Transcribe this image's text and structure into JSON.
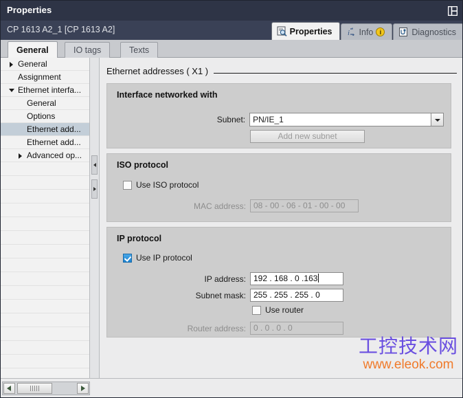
{
  "window": {
    "title": "Properties",
    "dock_icon": "panel-layout-icon",
    "device_name": "CP 1613 A2_1 [CP 1613 A2]"
  },
  "top_tabs": [
    {
      "label": "Properties",
      "icon": "properties-magnifier-icon",
      "active": true,
      "badge": ""
    },
    {
      "label": "Info",
      "icon": "info-arrow-icon",
      "active": false,
      "badge": "i"
    },
    {
      "label": "Diagnostics",
      "icon": "diagnostics-icon",
      "active": false,
      "badge": ""
    }
  ],
  "sub_tabs": [
    {
      "label": "General",
      "active": true
    },
    {
      "label": "IO tags",
      "active": false
    },
    {
      "label": "Texts",
      "active": false
    }
  ],
  "sidebar": {
    "items": [
      {
        "label": "General",
        "indent": 1,
        "arrow": "collapsed",
        "selected": false
      },
      {
        "label": "Assignment",
        "indent": 1,
        "arrow": "none",
        "selected": false
      },
      {
        "label": "Ethernet interfa...",
        "indent": 1,
        "arrow": "expanded",
        "selected": false
      },
      {
        "label": "General",
        "indent": 2,
        "arrow": "none",
        "selected": false
      },
      {
        "label": "Options",
        "indent": 2,
        "arrow": "none",
        "selected": false
      },
      {
        "label": "Ethernet add...",
        "indent": 2,
        "arrow": "none",
        "selected": true
      },
      {
        "label": "Ethernet add...",
        "indent": 2,
        "arrow": "none",
        "selected": false
      },
      {
        "label": "Advanced op...",
        "indent": 2,
        "arrow": "collapsed",
        "selected": false
      }
    ]
  },
  "splitter": {
    "collapse_left_icon": "collapse-left-arrow-icon",
    "collapse_right_icon": "collapse-right-arrow-icon"
  },
  "content": {
    "page_title": "Ethernet addresses ( X1 )",
    "groups": {
      "interface": {
        "title": "Interface networked with",
        "subnet_label": "Subnet:",
        "subnet_value": "PN/IE_1",
        "add_subnet_label": "Add new subnet"
      },
      "iso": {
        "title": "ISO protocol",
        "use_iso_label": "Use ISO protocol",
        "use_iso_checked": false,
        "mac_label": "MAC address:",
        "mac_value": "08  - 00  - 06  - 01  - 00  - 00"
      },
      "ip": {
        "title": "IP protocol",
        "use_ip_label": "Use IP protocol",
        "use_ip_checked": true,
        "ip_label": "IP address:",
        "ip_value": "192 . 168 . 0    .163",
        "mask_label": "Subnet mask:",
        "mask_value": "255 . 255 . 255 . 0",
        "use_router_label": "Use router",
        "use_router_checked": false,
        "router_label": "Router address:",
        "router_value": "0     .  0     .  0     .  0"
      }
    }
  },
  "bottom": {
    "scroll_left_icon": "scroll-left-arrow-icon",
    "scroll_right_icon": "scroll-right-arrow-icon"
  },
  "watermark": {
    "chinese": "工控技术网",
    "url": "www.eleok.com",
    "chinese_color": "#6a4fe0",
    "url_color": "#f07a2a"
  }
}
